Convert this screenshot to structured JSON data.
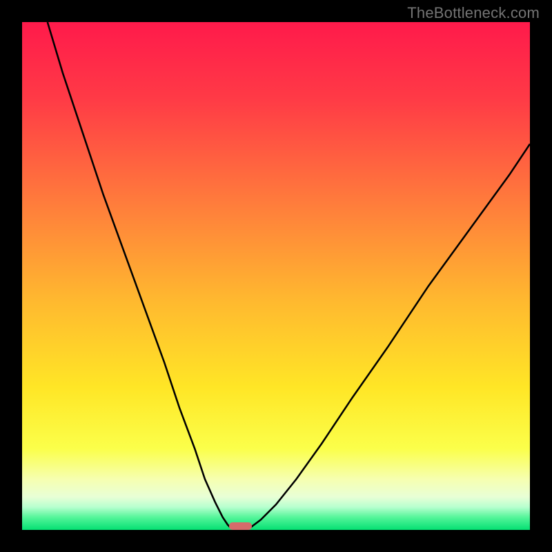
{
  "watermark": "TheBottleneck.com",
  "chart_data": {
    "type": "line",
    "title": "",
    "xlabel": "",
    "ylabel": "",
    "xlim": [
      0,
      100
    ],
    "ylim": [
      0,
      100
    ],
    "grid": false,
    "legend": false,
    "series": [
      {
        "name": "left-curve",
        "x": [
          5,
          8,
          12,
          16,
          20,
          24,
          28,
          31,
          34,
          36,
          38,
          39.5,
          40.5,
          41
        ],
        "y": [
          100,
          90,
          78,
          66,
          55,
          44,
          33,
          24,
          16,
          10,
          5.5,
          2.5,
          1,
          0.5
        ]
      },
      {
        "name": "right-curve",
        "x": [
          45,
          47,
          50,
          54,
          59,
          65,
          72,
          80,
          88,
          96,
          100
        ],
        "y": [
          0.5,
          2,
          5,
          10,
          17,
          26,
          36,
          48,
          59,
          70,
          76
        ]
      }
    ],
    "marker": {
      "x_center_pct": 43,
      "width_pct": 4.6,
      "y_pct": 0.7
    },
    "gradient_stops": [
      {
        "offset": 0,
        "color": "#ff1a4b"
      },
      {
        "offset": 0.15,
        "color": "#ff3a46"
      },
      {
        "offset": 0.35,
        "color": "#ff7a3c"
      },
      {
        "offset": 0.55,
        "color": "#ffb92f"
      },
      {
        "offset": 0.72,
        "color": "#ffe626"
      },
      {
        "offset": 0.84,
        "color": "#fbff4a"
      },
      {
        "offset": 0.9,
        "color": "#f6ffb0"
      },
      {
        "offset": 0.935,
        "color": "#e8ffd6"
      },
      {
        "offset": 0.955,
        "color": "#b7ffcf"
      },
      {
        "offset": 0.975,
        "color": "#55f59a"
      },
      {
        "offset": 1.0,
        "color": "#05e073"
      }
    ]
  }
}
